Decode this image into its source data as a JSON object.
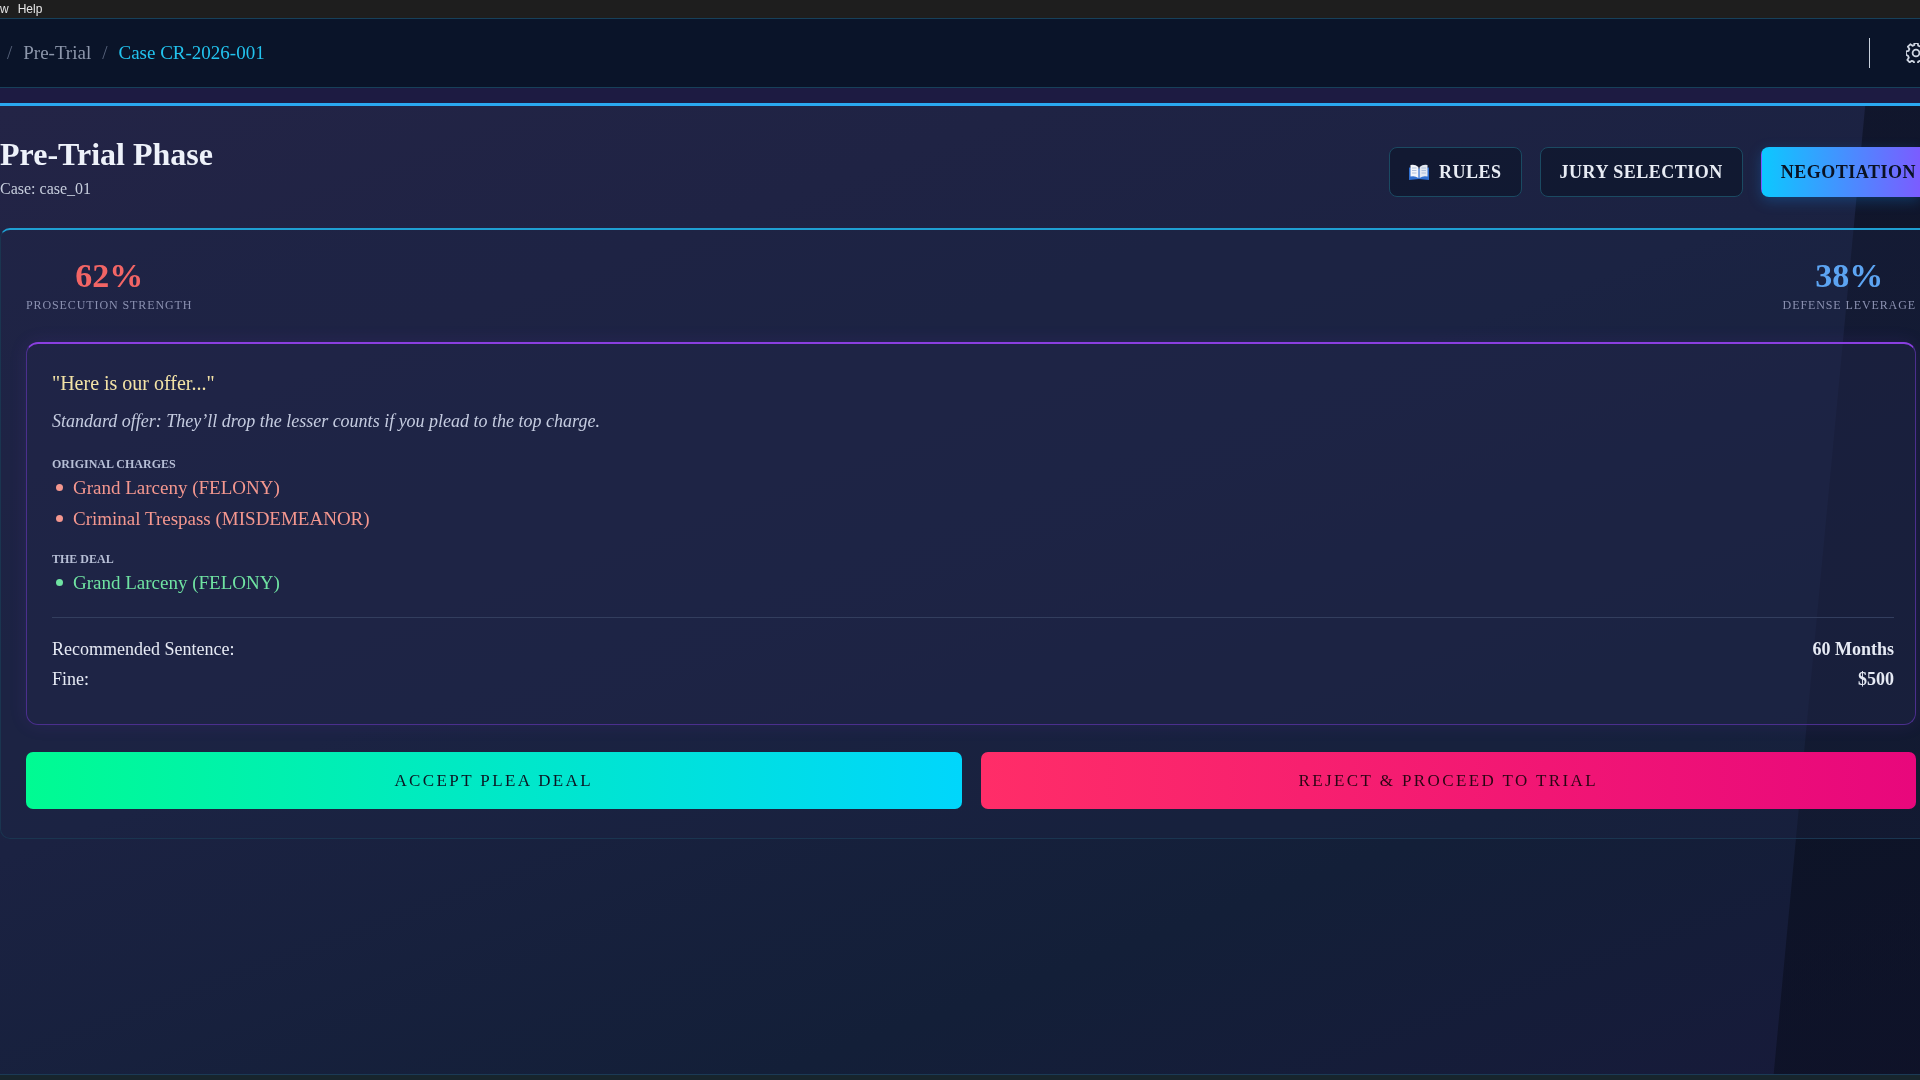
{
  "menu_bar": {
    "items": [
      "w",
      "Help"
    ]
  },
  "breadcrumb": [
    {
      "separator": "/",
      "label": "Pre-Trial",
      "current": false
    },
    {
      "separator": "/",
      "label": "Case CR-2026-001",
      "current": true
    }
  ],
  "phase": {
    "title": "Pre-Trial Phase",
    "case_label": "Case: case_01"
  },
  "tabs": [
    {
      "label": "RULES",
      "kind": "icon",
      "selected": false
    },
    {
      "label": "JURY SELECTION",
      "kind": "plain",
      "selected": false
    },
    {
      "label": "NEGOTIATION",
      "kind": "plain",
      "selected": true
    }
  ],
  "stats": [
    {
      "value": "62%",
      "label": "PROSECUTION STRENGTH",
      "color": "#f26565"
    },
    {
      "value": "38%",
      "label": "DEFENSE LEVERAGE",
      "color": "#5ca4f2"
    }
  ],
  "offer": {
    "quote": "\"Here is our offer...\"",
    "description": "Standard offer: They’ll drop the lesser counts if you plead to the top charge.",
    "sections": [
      {
        "heading": "ORIGINAL CHARGES",
        "kind": "original",
        "items": [
          "Grand Larceny (FELONY)",
          "Criminal Trespass (MISDEMEANOR)"
        ]
      },
      {
        "heading": "THE DEAL",
        "kind": "deal",
        "items": [
          "Grand Larceny (FELONY)"
        ]
      }
    ],
    "terms": [
      {
        "label": "Recommended Sentence:",
        "value": "60 Months"
      },
      {
        "label": "Fine:",
        "value": "$500"
      }
    ]
  },
  "actions": [
    {
      "label": "ACCEPT PLEA DEAL",
      "kind": "accept"
    },
    {
      "label": "REJECT & PROCEED TO TRIAL",
      "kind": "reject"
    }
  ]
}
